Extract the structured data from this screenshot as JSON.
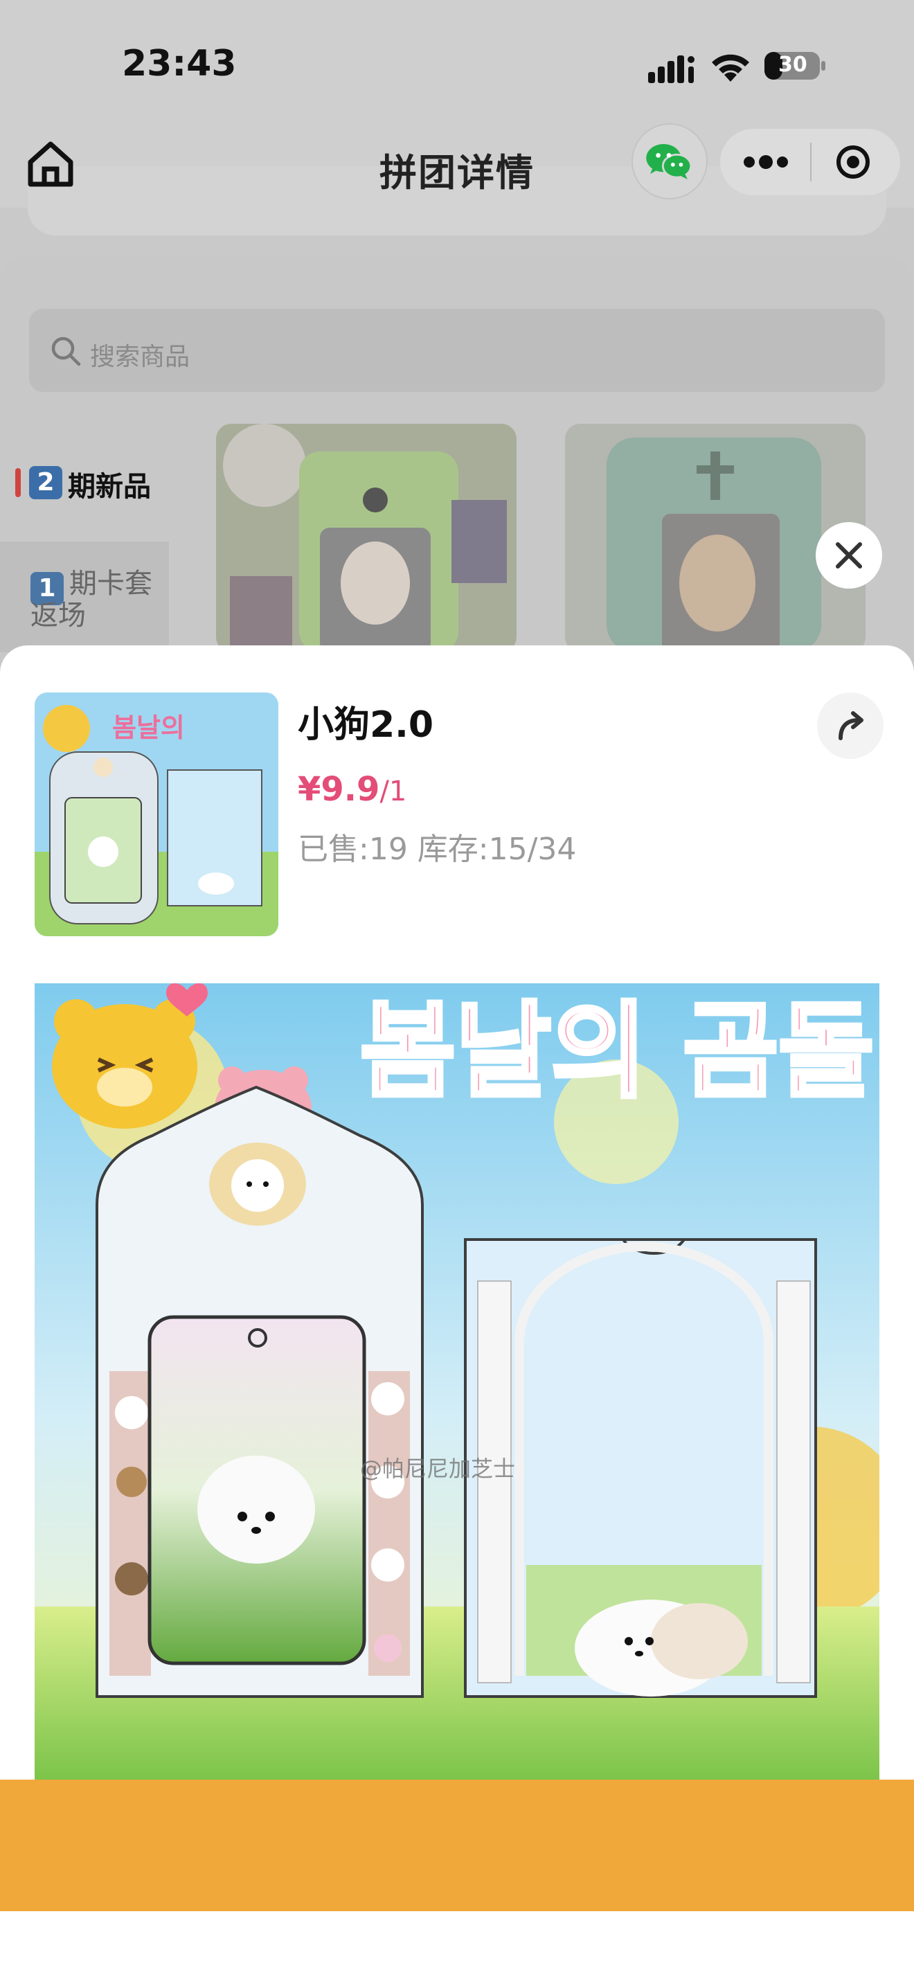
{
  "status_bar": {
    "time": "23:43",
    "battery": "30"
  },
  "nav": {
    "title": "拼团详情"
  },
  "search": {
    "placeholder": "搜索商品"
  },
  "sidebar": {
    "items": [
      {
        "badge": "2",
        "label": "期新品",
        "active": true
      },
      {
        "badge": "1",
        "label": "期卡套返场",
        "active": false
      }
    ]
  },
  "product": {
    "name": "小狗2.0",
    "price": "¥9.9",
    "price_unit": "/1",
    "stock_text": "已售:19 库存:15/34",
    "image_banner_text": "봄날의 곰돌",
    "watermark": "@帕尼尼加芝士"
  },
  "bottom_bar": {
    "label": "",
    "color": "#f1a83b"
  },
  "colors": {
    "accent": "#d0443f",
    "price": "#e34d77",
    "badge": "#3b6ea8"
  }
}
